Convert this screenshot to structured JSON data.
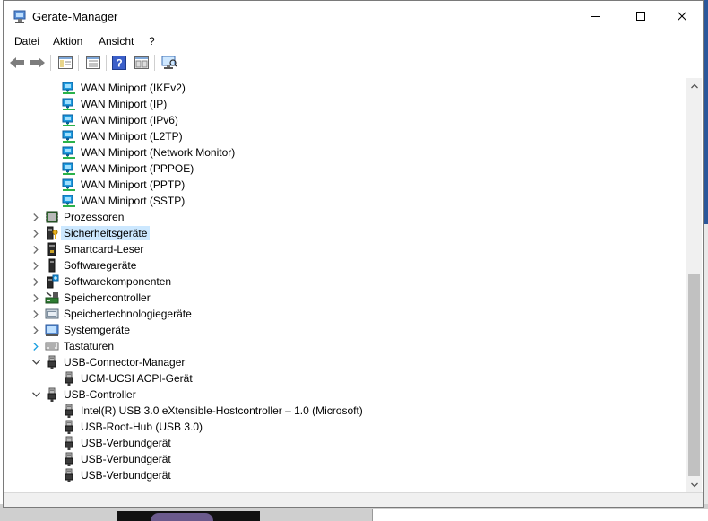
{
  "window": {
    "title": "Geräte-Manager"
  },
  "menu": {
    "items": [
      "Datei",
      "Aktion",
      "Ansicht",
      "?"
    ]
  },
  "toolbar": {
    "buttons": [
      "back-arrow-icon",
      "forward-arrow-icon",
      "show-hide-tree-icon",
      "properties-icon",
      "help-icon",
      "console-view-icon",
      "monitor-scan-icon"
    ]
  },
  "tree": {
    "rows": [
      {
        "label": "WAN Miniport (IKEv2)",
        "icon": "network-adapter-icon",
        "level": 2,
        "expander": ""
      },
      {
        "label": "WAN Miniport (IP)",
        "icon": "network-adapter-icon",
        "level": 2,
        "expander": ""
      },
      {
        "label": "WAN Miniport (IPv6)",
        "icon": "network-adapter-icon",
        "level": 2,
        "expander": ""
      },
      {
        "label": "WAN Miniport (L2TP)",
        "icon": "network-adapter-icon",
        "level": 2,
        "expander": ""
      },
      {
        "label": "WAN Miniport (Network Monitor)",
        "icon": "network-adapter-icon",
        "level": 2,
        "expander": ""
      },
      {
        "label": "WAN Miniport (PPPOE)",
        "icon": "network-adapter-icon",
        "level": 2,
        "expander": ""
      },
      {
        "label": "WAN Miniport (PPTP)",
        "icon": "network-adapter-icon",
        "level": 2,
        "expander": ""
      },
      {
        "label": "WAN Miniport (SSTP)",
        "icon": "network-adapter-icon",
        "level": 2,
        "expander": ""
      },
      {
        "label": "Prozessoren",
        "icon": "processor-icon",
        "level": 1,
        "expander": "collapsed"
      },
      {
        "label": "Sicherheitsgeräte",
        "icon": "security-device-icon",
        "level": 1,
        "expander": "collapsed",
        "selected": true
      },
      {
        "label": "Smartcard-Leser",
        "icon": "smartcard-reader-icon",
        "level": 1,
        "expander": "collapsed"
      },
      {
        "label": "Softwaregeräte",
        "icon": "software-device-icon",
        "level": 1,
        "expander": "collapsed"
      },
      {
        "label": "Softwarekomponenten",
        "icon": "software-component-icon",
        "level": 1,
        "expander": "collapsed"
      },
      {
        "label": "Speichercontroller",
        "icon": "storage-controller-icon",
        "level": 1,
        "expander": "collapsed"
      },
      {
        "label": "Speichertechnologiegeräte",
        "icon": "storage-technology-icon",
        "level": 1,
        "expander": "collapsed"
      },
      {
        "label": "Systemgeräte",
        "icon": "system-device-icon",
        "level": 1,
        "expander": "collapsed"
      },
      {
        "label": "Tastaturen",
        "icon": "keyboard-icon",
        "level": 1,
        "expander": "collapsed-hover"
      },
      {
        "label": "USB-Connector-Manager",
        "icon": "usb-plug-icon",
        "level": 1,
        "expander": "expanded"
      },
      {
        "label": "UCM-UCSI ACPI-Gerät",
        "icon": "usb-plug-icon",
        "level": 2,
        "expander": ""
      },
      {
        "label": "USB-Controller",
        "icon": "usb-plug-icon",
        "level": 1,
        "expander": "expanded"
      },
      {
        "label": "Intel(R) USB 3.0 eXtensible-Hostcontroller – 1.0 (Microsoft)",
        "icon": "usb-plug-icon",
        "level": 2,
        "expander": ""
      },
      {
        "label": "USB-Root-Hub (USB 3.0)",
        "icon": "usb-plug-icon",
        "level": 2,
        "expander": ""
      },
      {
        "label": "USB-Verbundgerät",
        "icon": "usb-plug-icon",
        "level": 2,
        "expander": ""
      },
      {
        "label": "USB-Verbundgerät",
        "icon": "usb-plug-icon",
        "level": 2,
        "expander": ""
      },
      {
        "label": "USB-Verbundgerät",
        "icon": "usb-plug-icon",
        "level": 2,
        "expander": ""
      }
    ]
  },
  "colors": {
    "selection": "#cce8ff",
    "hover_chevron": "#1a9fe0",
    "scroll_thumb": "#c1c1c1"
  }
}
